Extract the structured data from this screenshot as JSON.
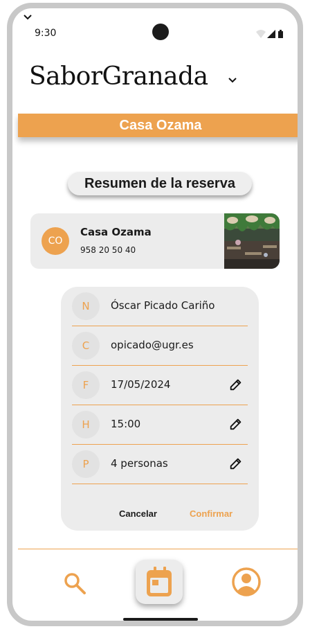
{
  "status_bar": {
    "time": "9:30"
  },
  "app": {
    "title": "SaborGranada"
  },
  "restaurant_bar": {
    "name": "Casa Ozama"
  },
  "summary": {
    "title": "Resumen de la reserva"
  },
  "restaurant_card": {
    "initials": "CO",
    "name": "Casa Ozama",
    "phone": "958 20 50 40"
  },
  "form": {
    "rows": [
      {
        "letter": "N",
        "value": "Óscar Picado Cariño",
        "editable": false
      },
      {
        "letter": "C",
        "value": "opicado@ugr.es",
        "editable": false
      },
      {
        "letter": "F",
        "value": "17/05/2024",
        "editable": true
      },
      {
        "letter": "H",
        "value": "15:00",
        "editable": true
      },
      {
        "letter": "P",
        "value": "4 personas",
        "editable": true
      }
    ],
    "cancel_label": "Cancelar",
    "confirm_label": "Confirmar"
  },
  "colors": {
    "accent": "#eda24f",
    "card_bg": "#ececec",
    "text": "#1a1a1a"
  },
  "icons": {
    "nav": [
      "search-icon",
      "calendar-icon",
      "account-icon"
    ],
    "edit": "pencil-icon"
  }
}
